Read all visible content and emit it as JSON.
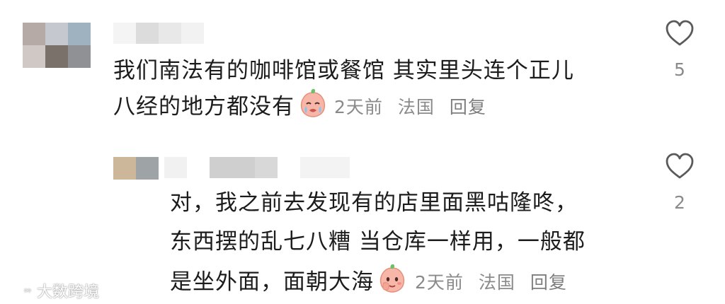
{
  "comments": [
    {
      "text_line1": "我们南法有的咖啡馆或餐馆 其实里头连个正儿",
      "text_line2": "八经的地方都没有",
      "time": "2天前",
      "location": "法国",
      "reply_label": "回复",
      "likes": "5",
      "emoji": "crying-peach-emoji",
      "like_icon": "heart-outline-icon"
    },
    {
      "text_line1": "对，我之前去发现有的店里面黑咕隆咚，",
      "text_line2": "东西摆的乱七八糟 当仓库一样用，一般都",
      "text_line3": "是坐外面，面朝大海",
      "time": "2天前",
      "location": "法国",
      "reply_label": "回复",
      "likes": "2",
      "emoji": "smirk-peach-emoji",
      "like_icon": "heart-outline-icon"
    }
  ],
  "watermark": {
    "text": "大数跨境",
    "icon": "weibo-logo-icon"
  },
  "colors": {
    "text": "#1c1c1c",
    "meta": "#8a8a8a",
    "background": "#ffffff"
  }
}
